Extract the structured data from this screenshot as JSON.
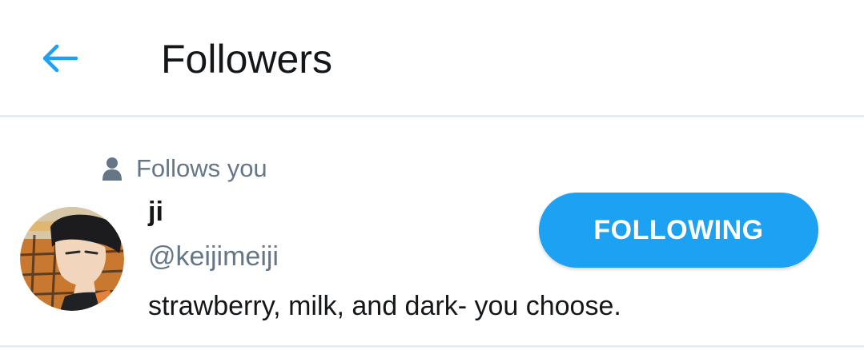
{
  "header": {
    "back_icon": "arrow-left-icon",
    "title": "Followers",
    "accent_color": "#1da1f2"
  },
  "follower": {
    "follows_you_icon": "person-icon",
    "follows_you_label": "Follows you",
    "avatar_description": "avatar-image",
    "display_name": "ji",
    "handle": "@keijimeiji",
    "bio": "strawberry, milk, and dark- you choose.",
    "follow_button_label": "FOLLOWING",
    "button_color": "#1da1f2",
    "secondary_text_color": "#657786"
  }
}
